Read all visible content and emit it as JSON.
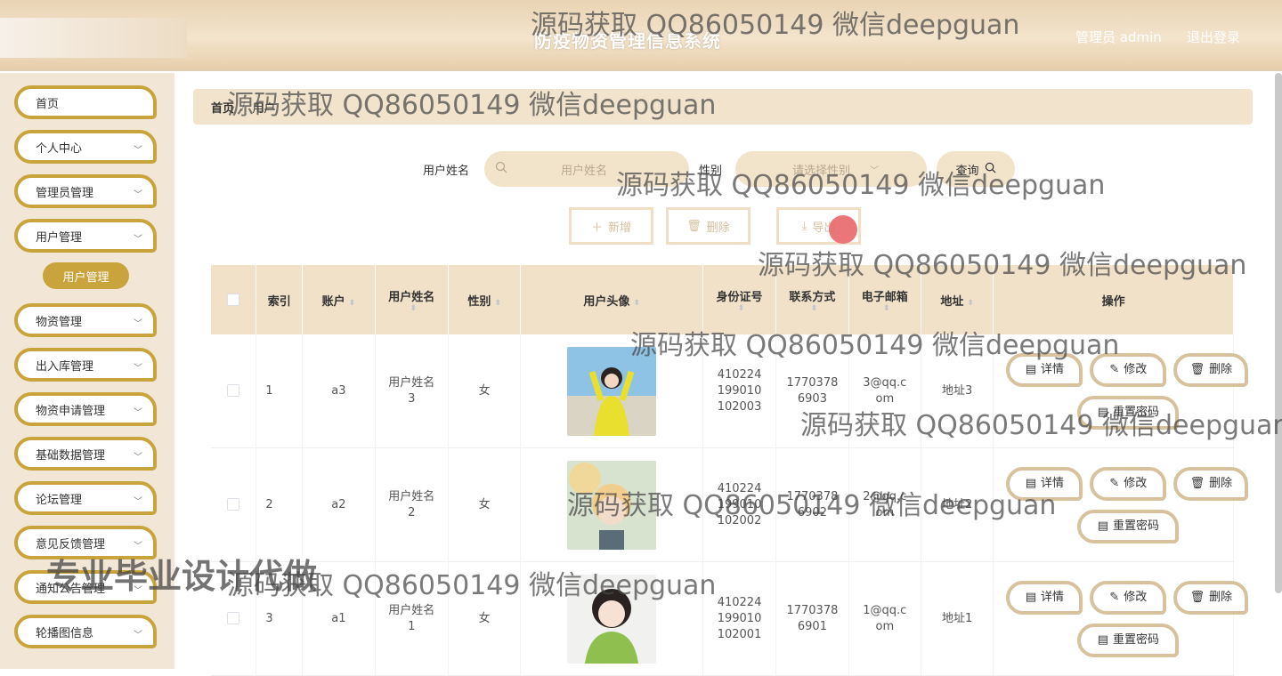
{
  "header": {
    "title": "防疫物资管理信息系统",
    "user_label": "管理员 admin",
    "logout_label": "退出登录"
  },
  "sidebar": {
    "items": [
      {
        "label": "首页",
        "has_chevron": false
      },
      {
        "label": "个人中心",
        "has_chevron": true
      },
      {
        "label": "管理员管理",
        "has_chevron": true
      },
      {
        "label": "用户管理",
        "has_chevron": true
      },
      {
        "label": "物资管理",
        "has_chevron": true
      },
      {
        "label": "出入库管理",
        "has_chevron": true
      },
      {
        "label": "物资申请管理",
        "has_chevron": true
      },
      {
        "label": "基础数据管理",
        "has_chevron": true
      },
      {
        "label": "论坛管理",
        "has_chevron": true
      },
      {
        "label": "意见反馈管理",
        "has_chevron": true
      },
      {
        "label": "通知公告管理",
        "has_chevron": true
      },
      {
        "label": "轮播图信息",
        "has_chevron": true
      }
    ],
    "active_sub": "用户管理"
  },
  "breadcrumb": {
    "home": "首页",
    "current": "用户"
  },
  "search": {
    "name_label": "用户姓名",
    "name_placeholder": "用户姓名",
    "sex_label": "性别",
    "sex_placeholder": "请选择性别",
    "query_label": "查询"
  },
  "actions": {
    "add": "新增",
    "delete": "删除",
    "export": "导出"
  },
  "table": {
    "headers": {
      "index": "索引",
      "account": "账户",
      "name": "用户姓名",
      "sex": "性别",
      "avatar": "用户头像",
      "idcard": "身份证号",
      "phone": "联系方式",
      "email": "电子邮箱",
      "address": "地址",
      "ops": "操作"
    },
    "rows": [
      {
        "index": "1",
        "account": "a3",
        "name": "用户姓名3",
        "sex": "女",
        "idcard": "410224199010102003",
        "phone": "17703786903",
        "email": "3@qq.com",
        "address": "地址3"
      },
      {
        "index": "2",
        "account": "a2",
        "name": "用户姓名2",
        "sex": "女",
        "idcard": "410224199010102002",
        "phone": "17703786902",
        "email": "2@qq.com",
        "address": "地址2"
      },
      {
        "index": "3",
        "account": "a1",
        "name": "用户姓名1",
        "sex": "女",
        "idcard": "410224199010102001",
        "phone": "17703786901",
        "email": "1@qq.com",
        "address": "地址1"
      }
    ],
    "op_labels": {
      "detail": "详情",
      "edit": "修改",
      "delete": "删除",
      "reset": "重置密码"
    }
  },
  "watermarks": {
    "text": "源码获取 QQ86050149 微信deepguan",
    "big": "专业毕业设计代做"
  },
  "colors": {
    "accent_gold": "#c9a43c",
    "header_beige": "#e9d3b3",
    "panel_beige": "#f1e3cc",
    "cursor_red": "#e8676b"
  }
}
